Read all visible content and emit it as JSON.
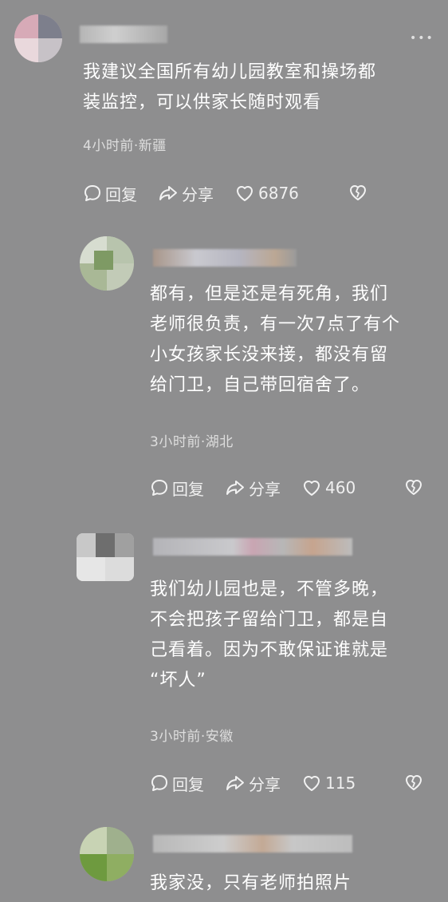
{
  "comments": [
    {
      "text": "我建议全国所有幼儿园教室和操场都\n装监控，可以供家长随时观看",
      "meta": "4小时前·新疆",
      "reply": "回复",
      "share": "分享",
      "likes": "6876"
    },
    {
      "text": "都有，但是还是有死角，我们\n老师很负责，有一次7点了有个\n小女孩家长没来接，都没有留\n给门卫，自己带回宿舍了。",
      "meta": "3小时前·湖北",
      "reply": "回复",
      "share": "分享",
      "likes": "460"
    },
    {
      "text": "我们幼儿园也是，不管多晚，\n不会把孩子留给门卫，都是自\n己看着。因为不敢保证谁就是\n“坏人”",
      "meta": "3小时前·安徽",
      "reply": "回复",
      "share": "分享",
      "likes": "115"
    },
    {
      "text": "我家没，只有老师拍照片"
    }
  ],
  "icons": {
    "reply": "speech-bubble-icon",
    "share": "share-arrow-icon",
    "like": "heart-icon",
    "dislike": "broken-heart-icon"
  },
  "colors": {
    "background": "#8e8e8f",
    "text": "#ffffff",
    "meta": "#dedede"
  }
}
